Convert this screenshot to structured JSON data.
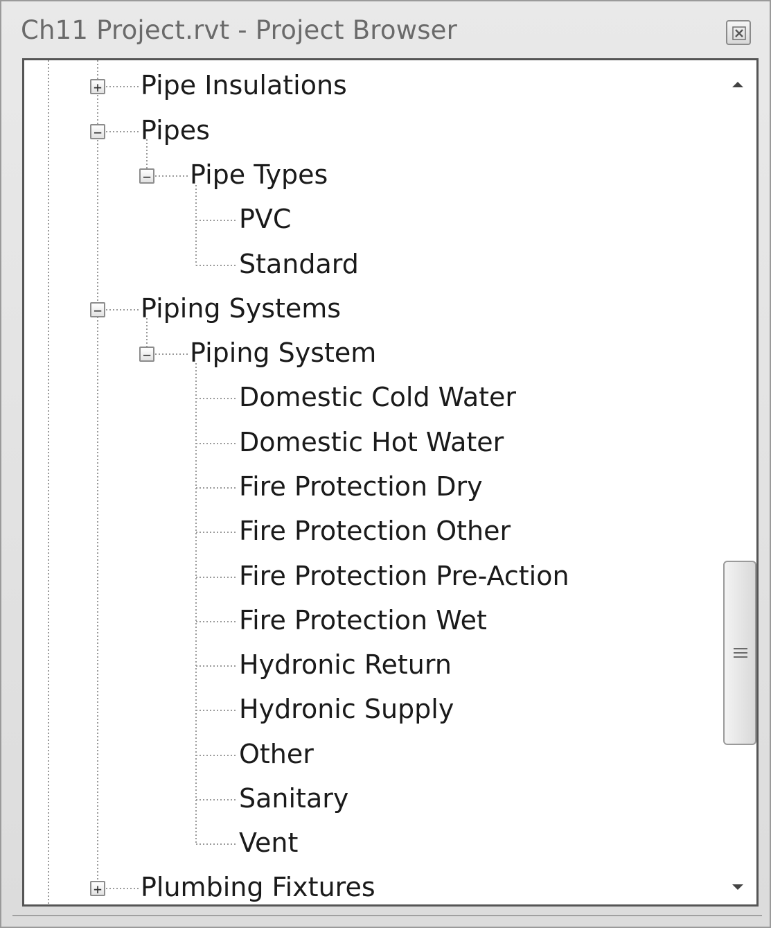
{
  "window": {
    "title": "Ch11 Project.rvt - Project Browser",
    "close_icon": "close-icon"
  },
  "tree": {
    "items": [
      {
        "label": "Pipe Insulations",
        "toggle": "+"
      },
      {
        "label": "Pipes",
        "toggle": "−"
      },
      {
        "label": "Pipe Types",
        "toggle": "−"
      },
      {
        "label": "PVC"
      },
      {
        "label": "Standard"
      },
      {
        "label": "Piping Systems",
        "toggle": "−"
      },
      {
        "label": "Piping System",
        "toggle": "−"
      },
      {
        "label": "Domestic Cold Water"
      },
      {
        "label": "Domestic Hot Water"
      },
      {
        "label": "Fire Protection Dry"
      },
      {
        "label": "Fire Protection Other"
      },
      {
        "label": "Fire Protection Pre-Action"
      },
      {
        "label": "Fire Protection Wet"
      },
      {
        "label": "Hydronic Return"
      },
      {
        "label": "Hydronic Supply"
      },
      {
        "label": "Other"
      },
      {
        "label": "Sanitary"
      },
      {
        "label": "Vent"
      },
      {
        "label": "Plumbing Fixtures",
        "toggle": "+"
      }
    ]
  },
  "scrollbar": {
    "up_icon": "scroll-up-arrow-icon",
    "down_icon": "scroll-down-arrow-icon",
    "grip_icon": "scroll-grip-icon"
  },
  "colors": {
    "title_text": "#6a6a6a",
    "tree_text": "#1a1a1a",
    "frame_border": "#555555"
  }
}
